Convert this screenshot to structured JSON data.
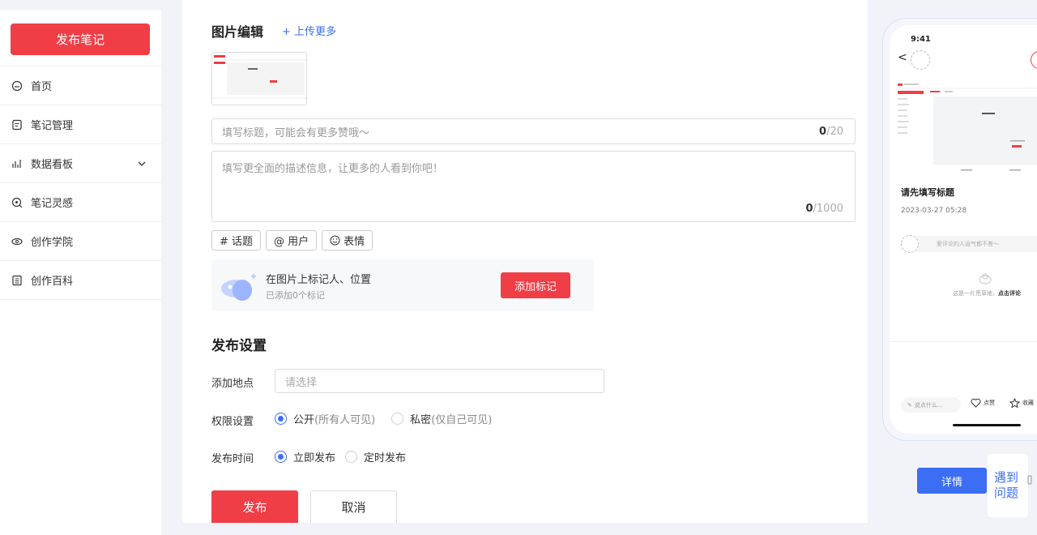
{
  "sidebar": {
    "publish_note": "发布笔记",
    "items": [
      {
        "label": "首页",
        "icon": "home-icon"
      },
      {
        "label": "笔记管理",
        "icon": "note-icon"
      },
      {
        "label": "数据看板",
        "icon": "chart-icon"
      },
      {
        "label": "笔记灵感",
        "icon": "inspiration-icon"
      },
      {
        "label": "创作学院",
        "icon": "academy-icon"
      },
      {
        "label": "创作百科",
        "icon": "wiki-icon"
      }
    ]
  },
  "editor": {
    "image_section_title": "图片编辑",
    "upload_more": "+ 上传更多",
    "title_placeholder": "填写标题，可能会有更多赞哦～",
    "title_count": "0",
    "title_max": "/20",
    "desc_placeholder": "填写更全面的描述信息，让更多的人看到你吧！",
    "desc_count": "0",
    "desc_max": "/1000",
    "tags": [
      "# 话题",
      "@ 用户",
      "表情"
    ],
    "mark": {
      "title": "在图片上标记人、位置",
      "subtitle": "已添加0个标记",
      "button": "添加标记"
    }
  },
  "settings": {
    "title": "发布设置",
    "location_label": "添加地点",
    "location_placeholder": "请选择",
    "permission_label": "权限设置",
    "permission_public": "公开",
    "permission_public_hint": "(所有人可见)",
    "permission_private": "私密",
    "permission_private_hint": "(仅自己可见)",
    "time_label": "发布时间",
    "time_now": "立即发布",
    "time_scheduled": "定时发布",
    "publish_button": "发布",
    "cancel_button": "取消"
  },
  "preview": {
    "time": "9:41",
    "note_title": "请先填写标题",
    "date": "2023-03-27 05:28",
    "comment_placeholder": "爱评论的人运气都不差～",
    "empty_text": "这是一片荒草地，",
    "empty_link": "点击评论",
    "say_something": "说点什么...",
    "like": "点赞",
    "collect": "收藏"
  },
  "detail_button": "详情",
  "help": "遇到问题",
  "colors": {
    "accent": "#ef3e46",
    "link": "#3b6ef5"
  }
}
